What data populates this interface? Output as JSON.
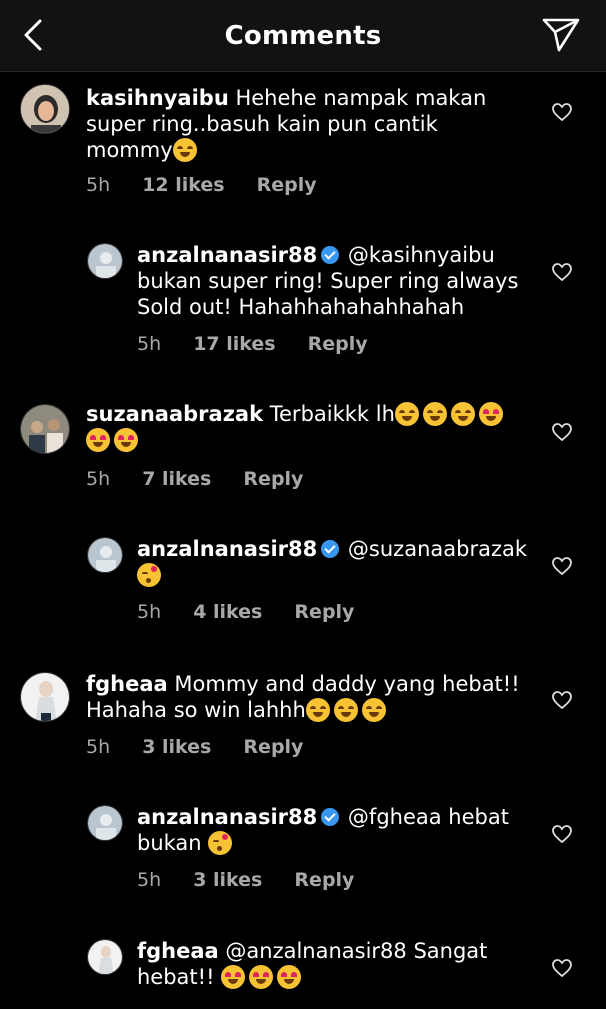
{
  "header": {
    "title": "Comments",
    "back_icon": "chevron-left-icon",
    "send_icon": "paper-plane-icon"
  },
  "comments": [
    {
      "username": "kasihnyaibu",
      "verified": false,
      "text_lines": [
        "Hehehe nampak makan",
        "super ring..basuh kain pun cantik",
        "mommy"
      ],
      "time": "5h",
      "likes": "12 likes",
      "reply": "Reply"
    },
    {
      "username": "anzalnanasir88",
      "verified": true,
      "text_lines": [
        "@kasihnyaibu",
        "bukan super ring! Super ring always",
        "Sold out! Hahahhahahahhahah"
      ],
      "time": "5h",
      "likes": "17 likes",
      "reply": "Reply"
    },
    {
      "username": "suzanaabrazak",
      "verified": false,
      "text_lines": [
        "Terbaikkk lh"
      ],
      "time": "5h",
      "likes": "7 likes",
      "reply": "Reply"
    },
    {
      "username": "anzalnanasir88",
      "verified": true,
      "text_lines": [
        "@suzanaabrazak"
      ],
      "time": "5h",
      "likes": "4 likes",
      "reply": "Reply"
    },
    {
      "username": "fgheaa",
      "verified": false,
      "text_lines": [
        "Mommy and daddy yang hebat!!",
        "Hahaha so win lahhh"
      ],
      "time": "5h",
      "likes": "3 likes",
      "reply": "Reply"
    },
    {
      "username": "anzalnanasir88",
      "verified": true,
      "text_lines": [
        "@fgheaa hebat",
        "bukan"
      ],
      "time": "5h",
      "likes": "3 likes",
      "reply": "Reply"
    },
    {
      "username": "fgheaa",
      "verified": false,
      "text_lines": [
        "@anzalnanasir88 Sangat",
        "hebat!!"
      ],
      "time": "",
      "likes": "",
      "reply": ""
    }
  ],
  "colors": {
    "background": "#000000",
    "header_bg": "#121212",
    "text": "#ffffff",
    "meta": "#a8a8a8",
    "verified": "#3897f0"
  }
}
